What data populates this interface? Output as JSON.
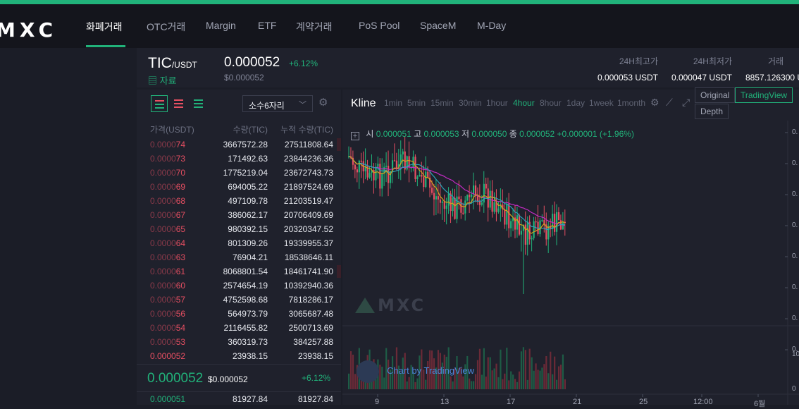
{
  "logo": "MXC",
  "nav": [
    {
      "label": "화폐거래",
      "active": true
    },
    {
      "label": "OTC거래"
    },
    {
      "label": "Margin"
    },
    {
      "label": "ETF"
    },
    {
      "label": "계약거래"
    },
    {
      "label": "PoS Pool"
    },
    {
      "label": "SpaceM"
    },
    {
      "label": "M-Day"
    }
  ],
  "market": {
    "base": "TIC",
    "quote": "/USDT",
    "info_label": "자료",
    "price": "0.000052",
    "change": "+6.12%",
    "usd_price": "$0.000052",
    "stats": [
      {
        "label": "24H최고가",
        "value": "0.000053 USDT"
      },
      {
        "label": "24H최저가",
        "value": "0.000047 USDT"
      },
      {
        "label": "거래",
        "value": "8857.126300 U"
      }
    ]
  },
  "orderbook": {
    "precision": "소수6자리",
    "headers": {
      "price": "가격(USDT)",
      "qty": "수량(TIC)",
      "cum": "누적 수량(TIC)"
    },
    "asks": [
      {
        "prefix": "0.0000",
        "suffix": "74",
        "qty": "3667572.28",
        "cum": "27511808.64",
        "depth": 1.0
      },
      {
        "prefix": "0.0000",
        "suffix": "73",
        "qty": "171492.63",
        "cum": "23844236.36",
        "depth": 0.0
      },
      {
        "prefix": "0.0000",
        "suffix": "70",
        "qty": "1775219.04",
        "cum": "23672743.73",
        "depth": 0.0
      },
      {
        "prefix": "0.0000",
        "suffix": "69",
        "qty": "694005.22",
        "cum": "21897524.69",
        "depth": 0.0
      },
      {
        "prefix": "0.0000",
        "suffix": "68",
        "qty": "497109.78",
        "cum": "21203519.47",
        "depth": 0.0
      },
      {
        "prefix": "0.0000",
        "suffix": "67",
        "qty": "386062.17",
        "cum": "20706409.69",
        "depth": 0.0
      },
      {
        "prefix": "0.0000",
        "suffix": "65",
        "qty": "980392.15",
        "cum": "20320347.52",
        "depth": 0.0
      },
      {
        "prefix": "0.0000",
        "suffix": "64",
        "qty": "801309.26",
        "cum": "19339955.37",
        "depth": 0.0
      },
      {
        "prefix": "0.0000",
        "suffix": "63",
        "qty": "76904.21",
        "cum": "18538646.11",
        "depth": 0.0
      },
      {
        "prefix": "0.0000",
        "suffix": "61",
        "qty": "8068801.54",
        "cum": "18461741.90",
        "depth": 1.0
      },
      {
        "prefix": "0.0000",
        "suffix": "60",
        "qty": "2574654.19",
        "cum": "10392940.36",
        "depth": 0.0
      },
      {
        "prefix": "0.0000",
        "suffix": "57",
        "qty": "4752598.68",
        "cum": "7818286.17",
        "depth": 0.0
      },
      {
        "prefix": "0.0000",
        "suffix": "56",
        "qty": "564973.79",
        "cum": "3065687.48",
        "depth": 0.0
      },
      {
        "prefix": "0.0000",
        "suffix": "54",
        "qty": "2116455.82",
        "cum": "2500713.69",
        "depth": 0.0
      },
      {
        "prefix": "0.0000",
        "suffix": "53",
        "qty": "360319.73",
        "cum": "384257.88",
        "depth": 0.0
      },
      {
        "prefix": "",
        "suffix": "0.000052",
        "qty": "23938.15",
        "cum": "23938.15",
        "depth": 0.0
      }
    ],
    "last_price": "0.000052",
    "last_usd": "$0.000052",
    "last_change": "+6.12%",
    "bid": {
      "price": "0.000051",
      "qty": "81927.84",
      "cum": "81927.84"
    }
  },
  "chart": {
    "title": "Kline",
    "intervals": [
      "1min",
      "5min",
      "15min",
      "30min",
      "1hour",
      "4hour",
      "8hour",
      "1day",
      "1week",
      "1month"
    ],
    "active_interval": "4hour",
    "views": [
      "Original",
      "TradingView",
      "Depth"
    ],
    "active_view": "TradingView",
    "legend": {
      "open_label": "시",
      "open": "0.000051",
      "high_label": "고",
      "high": "0.000053",
      "low_label": "저",
      "low": "0.000050",
      "close_label": "종",
      "close": "0.000052",
      "delta": "+0.000001 (+1.96%)"
    },
    "watermark": "MXC",
    "tv_label": "Chart by TradingView",
    "x_ticks": [
      "9",
      "13",
      "17",
      "21",
      "25",
      "12:00",
      "6월"
    ],
    "y_ticks": [
      "0.",
      "0.",
      "0.",
      "0.",
      "0.",
      "0.",
      "0.",
      "0.",
      "10",
      "0"
    ],
    "colors": {
      "up": "#21b27a",
      "down": "#e74f62",
      "ma_long": "#c42bc4",
      "ma_mid": "#2aa3b8",
      "ma_short": "#d6a21e"
    }
  },
  "chart_data": {
    "type": "candlestick",
    "title": "Kline",
    "interval": "4hour",
    "x_ticks": [
      "9",
      "13",
      "17",
      "21",
      "25",
      "12:00",
      "6월"
    ],
    "legend_ohlc": {
      "open": 5.1e-05,
      "high": 5.3e-05,
      "low": 5e-05,
      "close": 5.2e-05
    },
    "change": "+0.000001 (+1.96%)",
    "grid": false
  }
}
